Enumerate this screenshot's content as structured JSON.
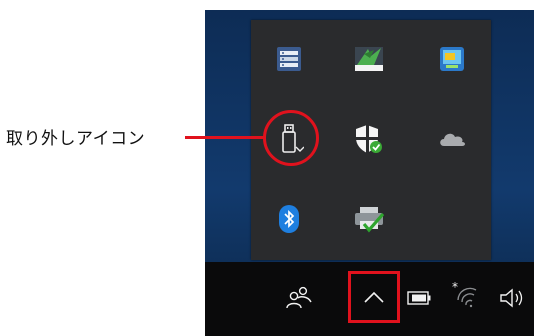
{
  "callout": {
    "label": "取り外しアイコン",
    "color": "#e0121d"
  },
  "flyout": {
    "icons": [
      {
        "name": "server-manager-icon"
      },
      {
        "name": "display-app-icon"
      },
      {
        "name": "intel-graphics-icon"
      },
      {
        "name": "usb-eject-icon"
      },
      {
        "name": "windows-security-icon"
      },
      {
        "name": "onedrive-icon"
      },
      {
        "name": "bluetooth-icon"
      },
      {
        "name": "printer-check-icon"
      }
    ]
  },
  "taskbar": {
    "icons": [
      "people-icon",
      "chevron-up-icon",
      "battery-icon",
      "wifi-icon",
      "speaker-icon"
    ],
    "highlighted": "chevron-up-icon"
  },
  "colors": {
    "accent": "#e0121d",
    "taskbar": "#0a0a0b",
    "flyout": "#2a2b2d"
  }
}
